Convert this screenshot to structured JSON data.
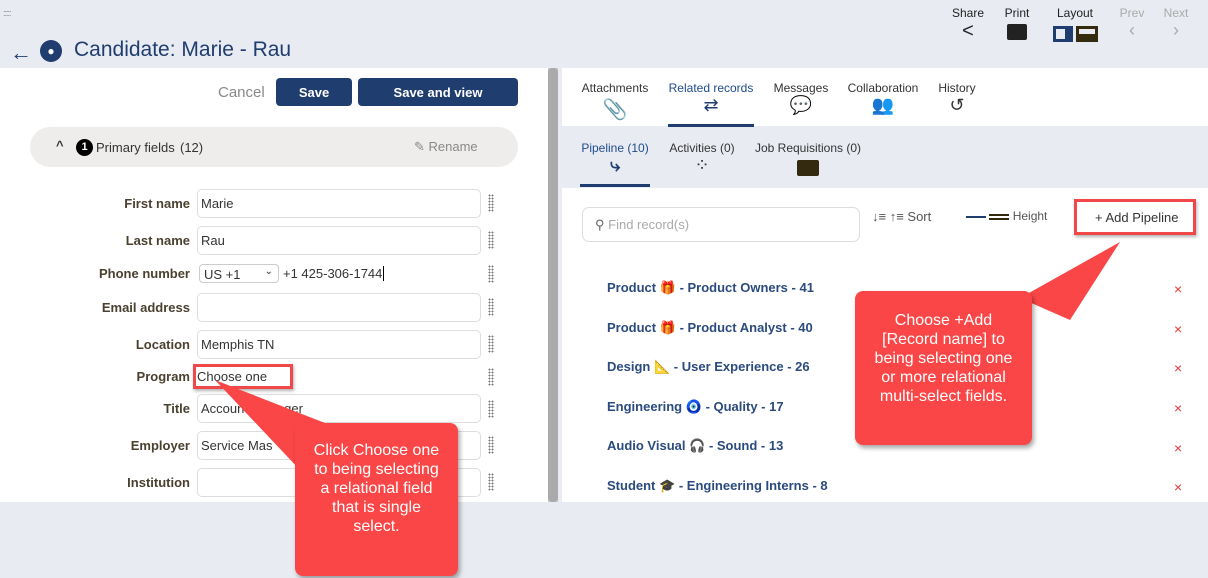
{
  "header": {
    "title": "Candidate: Marie - Rau",
    "share": "Share",
    "print": "Print",
    "layout": "Layout",
    "prev": "Prev",
    "next": "Next"
  },
  "form": {
    "cancel": "Cancel",
    "save": "Save",
    "save_view": "Save and view",
    "section": {
      "number": "1",
      "label": "Primary fields",
      "count": "(12)",
      "rename": "Rename"
    },
    "fields": [
      {
        "label": "First name",
        "value": "Marie"
      },
      {
        "label": "Last name",
        "value": "Rau"
      },
      {
        "label": "Phone number",
        "country": "US +1",
        "value": "+1 425-306-1744"
      },
      {
        "label": "Email address",
        "value": ""
      },
      {
        "label": "Location",
        "value": "Memphis TN"
      },
      {
        "label": "Program",
        "value": "Choose one"
      },
      {
        "label": "Title",
        "value": "Account Manager"
      },
      {
        "label": "Employer",
        "value": "Service Mas"
      },
      {
        "label": "Institution",
        "value": ""
      }
    ]
  },
  "tabs": [
    {
      "label": "Attachments",
      "icon": "paperclip"
    },
    {
      "label": "Related records",
      "icon": "relations",
      "active": true
    },
    {
      "label": "Messages",
      "icon": "chat"
    },
    {
      "label": "Collaboration",
      "icon": "users"
    },
    {
      "label": "History",
      "icon": "history"
    }
  ],
  "subtabs": [
    {
      "label": "Pipeline (10)",
      "icon": "pipeline",
      "active": true
    },
    {
      "label": "Activities (0)",
      "icon": "dots"
    },
    {
      "label": "Job Requisitions (0)",
      "icon": "briefcase"
    }
  ],
  "toolbar": {
    "search_placeholder": "Find record(s)",
    "sort": "Sort",
    "height": "Height",
    "add": "+ Add Pipeline"
  },
  "records": [
    {
      "category": "Product",
      "emoji": "🎁",
      "name": "- Product Owners - 41"
    },
    {
      "category": "Product",
      "emoji": "🎁",
      "name": "- Product Analyst - 40"
    },
    {
      "category": "Design",
      "emoji": "📐",
      "name": "- User Experience - 26"
    },
    {
      "category": "Engineering",
      "emoji": "🧿",
      "name": "- Quality - 17"
    },
    {
      "category": "Audio Visual",
      "emoji": "🎧",
      "name": "- Sound - 13"
    },
    {
      "category": "Student",
      "emoji": "🎓",
      "name": "- Engineering Interns - 8"
    }
  ],
  "remove_symbol": "×",
  "callouts": {
    "left": "Click Choose one to being selecting a relational field that is single select.",
    "right": "Choose +Add [Record name] to being selecting one or more relational multi-select fields."
  },
  "colors": {
    "primary": "#1f3d6e",
    "callout": "#fa4646",
    "remove": "#e33333"
  }
}
